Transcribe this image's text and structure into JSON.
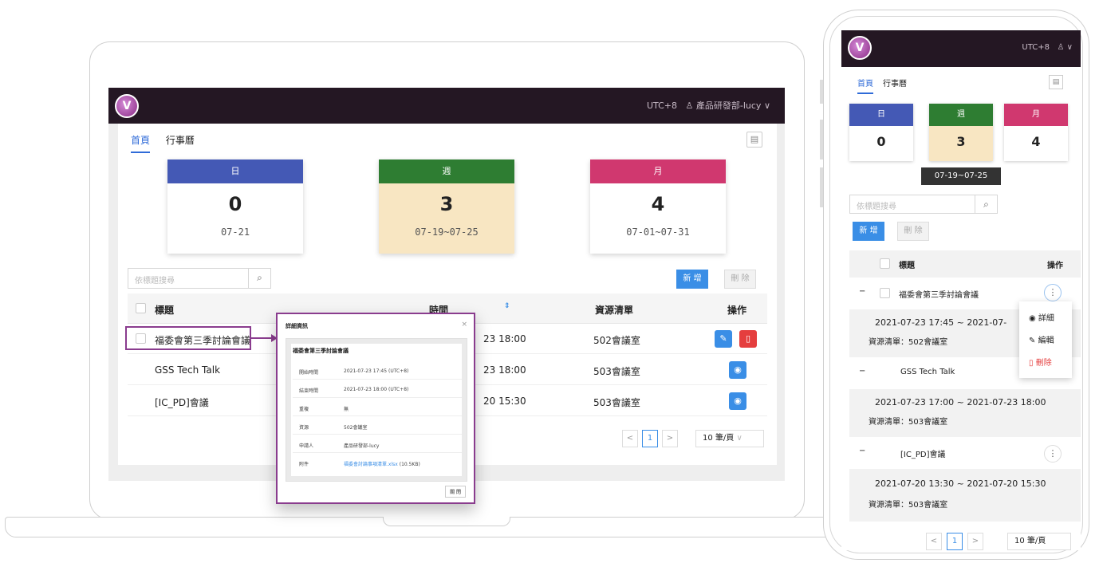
{
  "header": {
    "timezone": "UTC+8",
    "user": "產品研發部-lucy",
    "logo_letter": "V"
  },
  "tabs": [
    {
      "label": "首頁"
    },
    {
      "label": "行事曆"
    }
  ],
  "stats": [
    {
      "label": "日",
      "count": "0",
      "range": "07-21",
      "color": "#4459b5"
    },
    {
      "label": "週",
      "count": "3",
      "range": "07-19~07-25",
      "color": "#2e7d32"
    },
    {
      "label": "月",
      "count": "4",
      "range": "07-01~07-31",
      "color": "#d0386f"
    }
  ],
  "search": {
    "placeholder": "依標題搜尋"
  },
  "actions": {
    "add": "新 增",
    "delete": "刪 除"
  },
  "table": {
    "headers": {
      "title": "標題",
      "time": "時間",
      "resource": "資源清單",
      "ops": "操作"
    },
    "rows": [
      {
        "title": "福委會第三季討論會議",
        "time": "23 18:00",
        "resource": "502會議室"
      },
      {
        "title": "GSS Tech Talk",
        "time": "23 18:00",
        "resource": "503會議室"
      },
      {
        "title": "[IC_PD]會議",
        "time": "20 15:30",
        "resource": "503會議室"
      }
    ]
  },
  "pagination": {
    "current": "1",
    "page_size": "10 筆/頁",
    "prev": "<",
    "next": ">"
  },
  "modal": {
    "title": "詳細資訊",
    "close": "×",
    "event_title": "福委會第三季討論會議",
    "fields": [
      {
        "k": "開始時間",
        "v": "2021-07-23 17:45 (UTC+8)"
      },
      {
        "k": "結束時間",
        "v": "2021-07-23 18:00 (UTC+8)"
      },
      {
        "k": "重複",
        "v": "無"
      },
      {
        "k": "資源",
        "v": "502會議室"
      },
      {
        "k": "申請人",
        "v": "產品研發部-lucy"
      },
      {
        "k": "附件",
        "v": "福委會討論事項清單.xlsx",
        "extra": "(10.5KB)"
      }
    ],
    "ok": "關 閉"
  },
  "mobile": {
    "timezone": "UTC+8",
    "tooltip": "07-19~07-25",
    "headers": {
      "title": "標題",
      "ops": "操作"
    },
    "items": [
      {
        "title": "福委會第三季討論會議",
        "time": "2021-07-23 17:45 ~ 2021-07-",
        "resource": "資源清單：502會議室"
      },
      {
        "title": "GSS Tech Talk",
        "time": "2021-07-23 17:00 ~ 2021-07-23 18:00",
        "resource": "資源清單：503會議室"
      },
      {
        "title": "[IC_PD]會議",
        "time": "2021-07-20 13:30 ~ 2021-07-20 15:30",
        "resource": "資源清單：503會議室"
      }
    ],
    "menu": {
      "detail": "詳細",
      "edit": "編輯",
      "delete": "刪除"
    },
    "collapse": "−",
    "more": "⋮"
  }
}
